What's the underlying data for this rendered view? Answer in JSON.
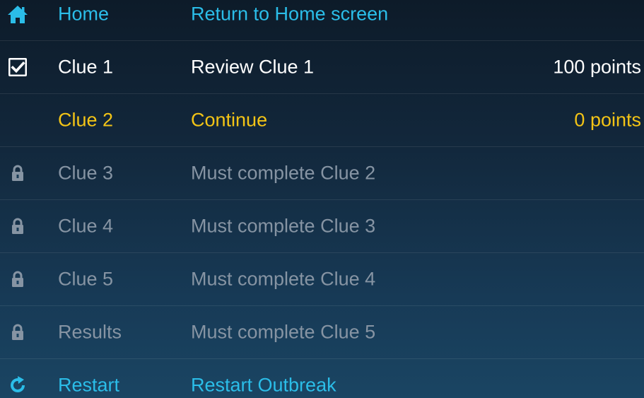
{
  "colors": {
    "accent_blue": "#2bbde8",
    "completed_white": "#ffffff",
    "current_yellow": "#f3c416",
    "locked_gray": "#8694a3"
  },
  "rows": [
    {
      "icon": "home-icon",
      "label": "Home",
      "action": "Return to Home screen",
      "points": ""
    },
    {
      "icon": "checked-checkbox-icon",
      "label": "Clue 1",
      "action": "Review Clue 1",
      "points": "100 points"
    },
    {
      "icon": "",
      "label": "Clue 2",
      "action": "Continue",
      "points": "0 points"
    },
    {
      "icon": "lock-icon",
      "label": "Clue 3",
      "action": "Must complete Clue 2",
      "points": ""
    },
    {
      "icon": "lock-icon",
      "label": "Clue 4",
      "action": "Must complete Clue 3",
      "points": ""
    },
    {
      "icon": "lock-icon",
      "label": "Clue 5",
      "action": "Must complete Clue 4",
      "points": ""
    },
    {
      "icon": "lock-icon",
      "label": "Results",
      "action": "Must complete Clue 5",
      "points": ""
    },
    {
      "icon": "restart-icon",
      "label": "Restart",
      "action": "Restart Outbreak",
      "points": ""
    }
  ]
}
